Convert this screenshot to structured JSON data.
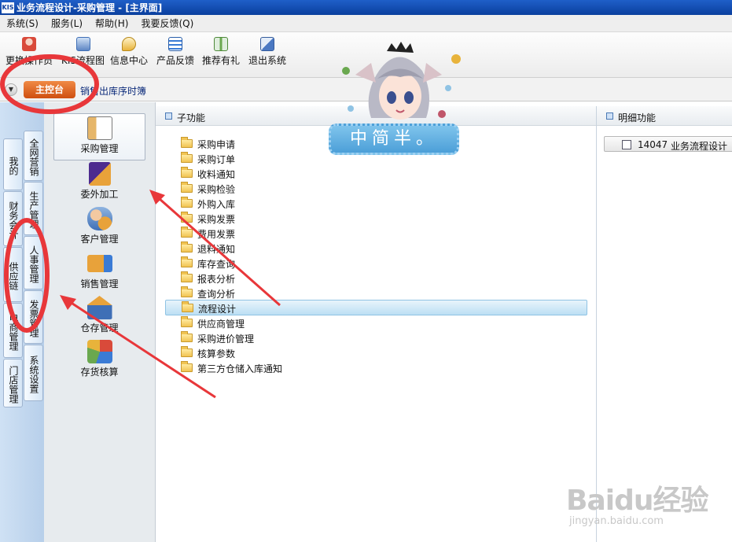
{
  "window": {
    "title": "业务流程设计-采购管理 - [主界面]",
    "icon_text": "KIS"
  },
  "menu": [
    "系统(S)",
    "服务(L)",
    "帮助(H)",
    "我要反馈(Q)"
  ],
  "toolbar": [
    {
      "label": "更换操作员",
      "icon": "switch-user-icon",
      "color": "#d94a3a"
    },
    {
      "label": "KIS流程图",
      "icon": "flowchart-icon",
      "color": "#3f6fb6"
    },
    {
      "label": "信息中心",
      "icon": "message-icon",
      "color": "#e8b33b"
    },
    {
      "label": "产品反馈",
      "icon": "feedback-icon",
      "color": "#3a7bd5"
    },
    {
      "label": "推荐有礼",
      "icon": "gift-icon",
      "color": "#6aa84f"
    },
    {
      "label": "退出系统",
      "icon": "exit-icon",
      "color": "#4a78c2"
    }
  ],
  "tabs": {
    "main": "主控台",
    "secondary": "销售出库序时簿"
  },
  "side_tabs": [
    {
      "label": "我的KIS"
    },
    {
      "label": "全网营销"
    },
    {
      "label": "财务会计"
    },
    {
      "label": "生产管理"
    },
    {
      "label": "供应链"
    },
    {
      "label": "人事管理"
    },
    {
      "label": "电商管理"
    },
    {
      "label": "发票管理"
    },
    {
      "label": "门店管理"
    },
    {
      "label": "系统设置"
    }
  ],
  "modules": [
    {
      "label": "采购管理",
      "icon": "purchase-icon",
      "selected": true
    },
    {
      "label": "委外加工",
      "icon": "outsourcing-icon",
      "selected": false
    },
    {
      "label": "客户管理",
      "icon": "customer-icon",
      "selected": false
    },
    {
      "label": "销售管理",
      "icon": "sales-truck-icon",
      "selected": false
    },
    {
      "label": "仓存管理",
      "icon": "warehouse-icon",
      "selected": false
    },
    {
      "label": "存货核算",
      "icon": "inventory-accounting-icon",
      "selected": false
    }
  ],
  "subfunctions": {
    "header": "子功能",
    "items": [
      "采购申请",
      "采购订单",
      "收料通知",
      "采购检验",
      "外购入库",
      "采购发票",
      "费用发票",
      "退料通知",
      "库存查询",
      "报表分析",
      "查询分析",
      "流程设计",
      "供应商管理",
      "采购进价管理",
      "核算参数",
      "第三方仓储入库通知"
    ],
    "selected": "流程设计"
  },
  "details": {
    "header": "明细功能",
    "items": [
      {
        "code": "14047",
        "name": "业务流程设计"
      }
    ]
  },
  "mascot_text": "中简半。",
  "watermark": {
    "logo": "Baidu经验",
    "url": "jingyan.baidu.com"
  },
  "annotation_color": "#e8373a"
}
